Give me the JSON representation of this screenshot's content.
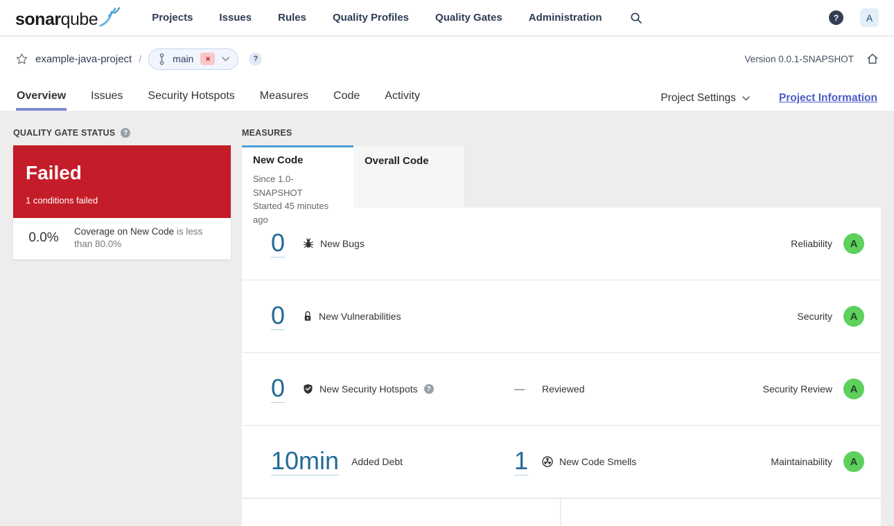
{
  "nav": {
    "logo": {
      "bold": "sonar",
      "light": "qube"
    },
    "items": [
      "Projects",
      "Issues",
      "Rules",
      "Quality Profiles",
      "Quality Gates",
      "Administration"
    ],
    "help_glyph": "?",
    "avatar_letter": "A"
  },
  "breadcrumb": {
    "project": "example-java-project",
    "separator": "/",
    "branch": "main",
    "branch_badge": "×",
    "help_glyph": "?"
  },
  "header_right": {
    "version_label": "Version 0.0.1-SNAPSHOT"
  },
  "tabs": {
    "items": [
      "Overview",
      "Issues",
      "Security Hotspots",
      "Measures",
      "Code",
      "Activity"
    ],
    "active": "Overview",
    "project_settings": "Project Settings",
    "project_information": "Project Information"
  },
  "quality_gate": {
    "title": "QUALITY GATE STATUS",
    "help_glyph": "?",
    "status": "Failed",
    "conditions_summary": "1 conditions failed",
    "condition": {
      "value": "0.0%",
      "metric": "Coverage on New Code",
      "constraint": "is less than 80.0%"
    }
  },
  "measures": {
    "title": "MEASURES",
    "tabs": {
      "new_code": {
        "label": "New Code",
        "line1": "Since 1.0-SNAPSHOT",
        "line2": "Started 45 minutes ago"
      },
      "overall_code": {
        "label": "Overall Code"
      }
    },
    "rows": [
      {
        "value": "0",
        "icon": "bug-icon",
        "label": "New Bugs",
        "domain": "Reliability",
        "rating": "A"
      },
      {
        "value": "0",
        "icon": "lock-icon",
        "label": "New Vulnerabilities",
        "domain": "Security",
        "rating": "A"
      },
      {
        "value": "0",
        "icon": "shield-icon",
        "label": "New Security Hotspots",
        "help_glyph": "?",
        "dash": "—",
        "reviewed_label": "Reviewed",
        "domain": "Security Review",
        "rating": "A"
      },
      {
        "value": "10min",
        "label": "Added Debt",
        "value2": "1",
        "icon2": "code-smell-icon",
        "label2": "New Code Smells",
        "domain": "Maintainability",
        "rating": "A"
      }
    ]
  },
  "colors": {
    "failed_red": "#c41c28",
    "link_blue": "#236a97",
    "measures_tab_accent": "#4b9fd5",
    "overview_tab_underline": "#7d8cd1",
    "project_information_link": "#4d5cc5",
    "rating_a_green": "#5dd05d",
    "page_background": "#ededed"
  }
}
